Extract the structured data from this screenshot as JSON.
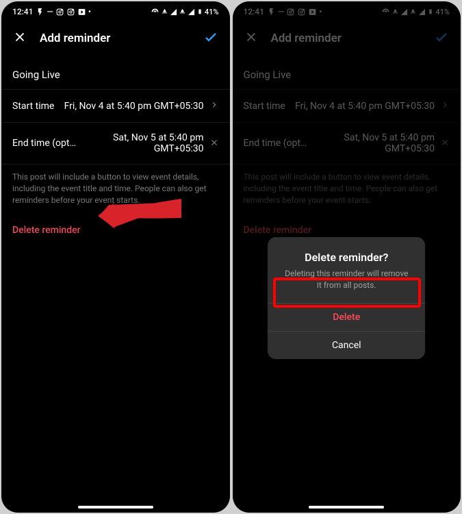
{
  "status": {
    "time": "12:41",
    "battery": "41%"
  },
  "header": {
    "title": "Add reminder"
  },
  "event": {
    "name": "Going Live"
  },
  "start": {
    "label": "Start time",
    "value": "Fri, Nov 4 at 5:40 pm GMT+05:30"
  },
  "end": {
    "label": "End time (opti…",
    "value": "Sat, Nov 5 at 5:40 pm GMT+05:30"
  },
  "info": "This post will include a button to view event details, including the event title and time. People can also get reminders before your event starts.",
  "delete_link": "Delete reminder",
  "dialog": {
    "title": "Delete reminder?",
    "body": "Deleting this reminder will remove it from all posts.",
    "delete": "Delete",
    "cancel": "Cancel"
  }
}
